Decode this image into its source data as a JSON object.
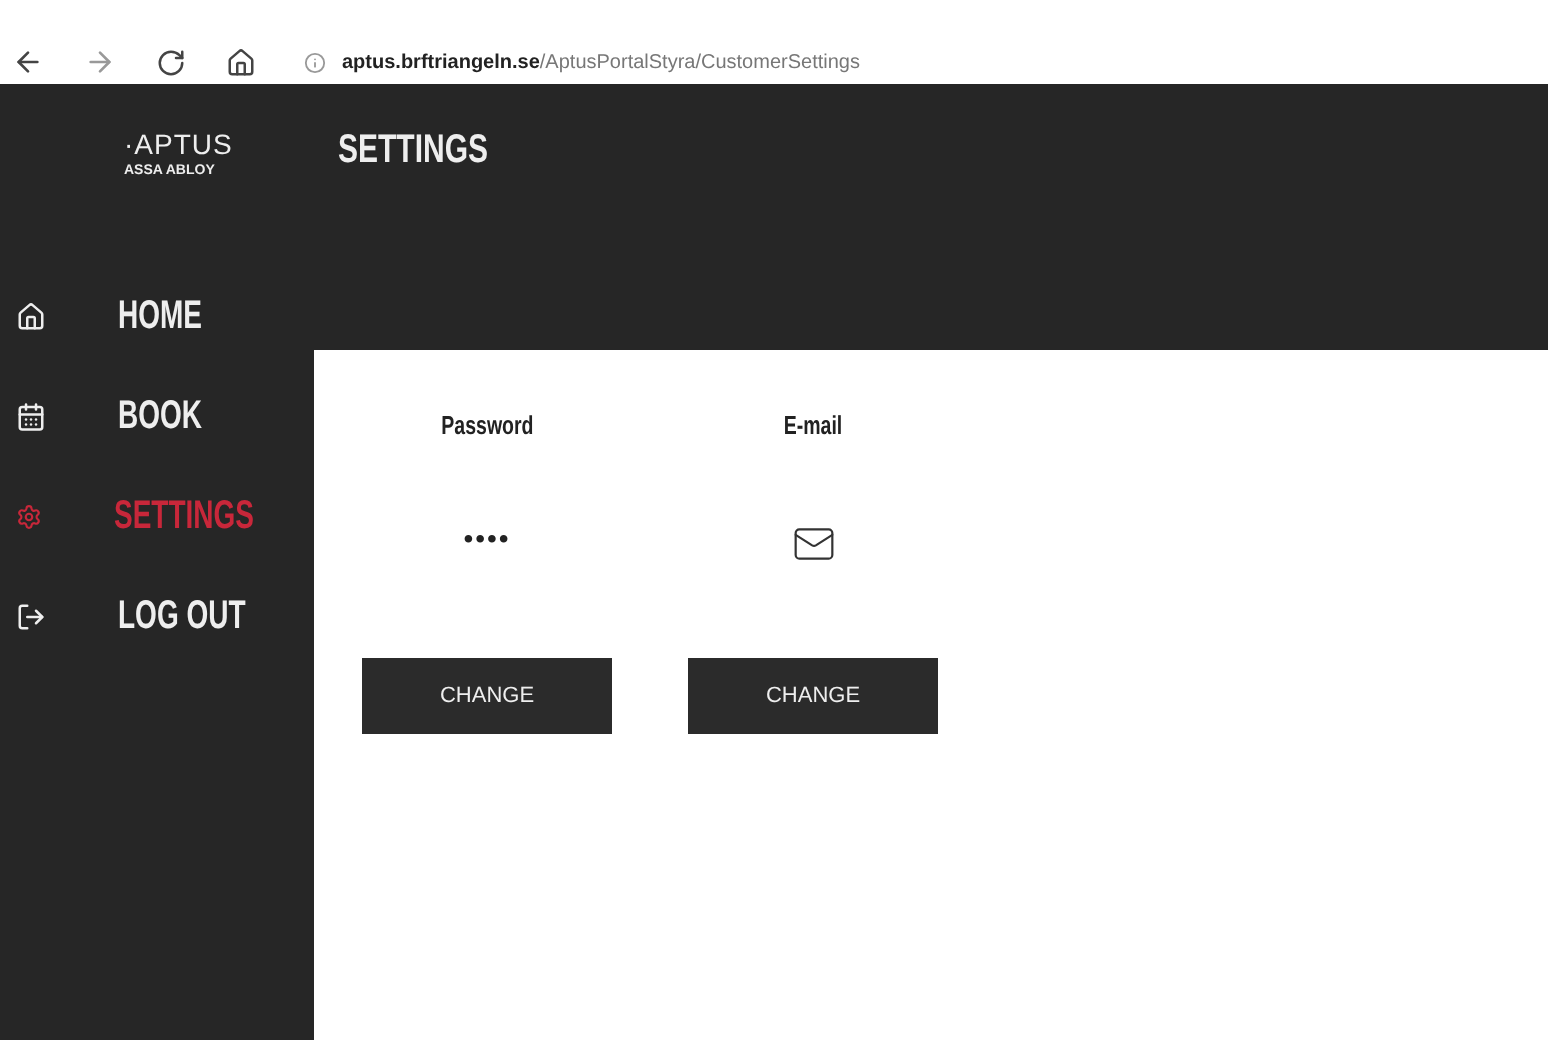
{
  "browser": {
    "url_host": "aptus.brftriangeln.se",
    "url_path": "/AptusPortalStyra/CustomerSettings"
  },
  "logo": {
    "name": "·APTUS",
    "tagline": "ASSA ABLOY"
  },
  "header": {
    "title": "SETTINGS"
  },
  "sidebar": {
    "items": [
      {
        "label": "HOME",
        "selected": false
      },
      {
        "label": "BOOK",
        "selected": false
      },
      {
        "label": "SETTINGS",
        "selected": true
      },
      {
        "label": "LOG OUT",
        "selected": false
      }
    ]
  },
  "settings": [
    {
      "label": "Password",
      "kind": "masked",
      "value": "••••",
      "button": "CHANGE"
    },
    {
      "label": "E-mail",
      "kind": "envelope",
      "button": "CHANGE"
    }
  ]
}
